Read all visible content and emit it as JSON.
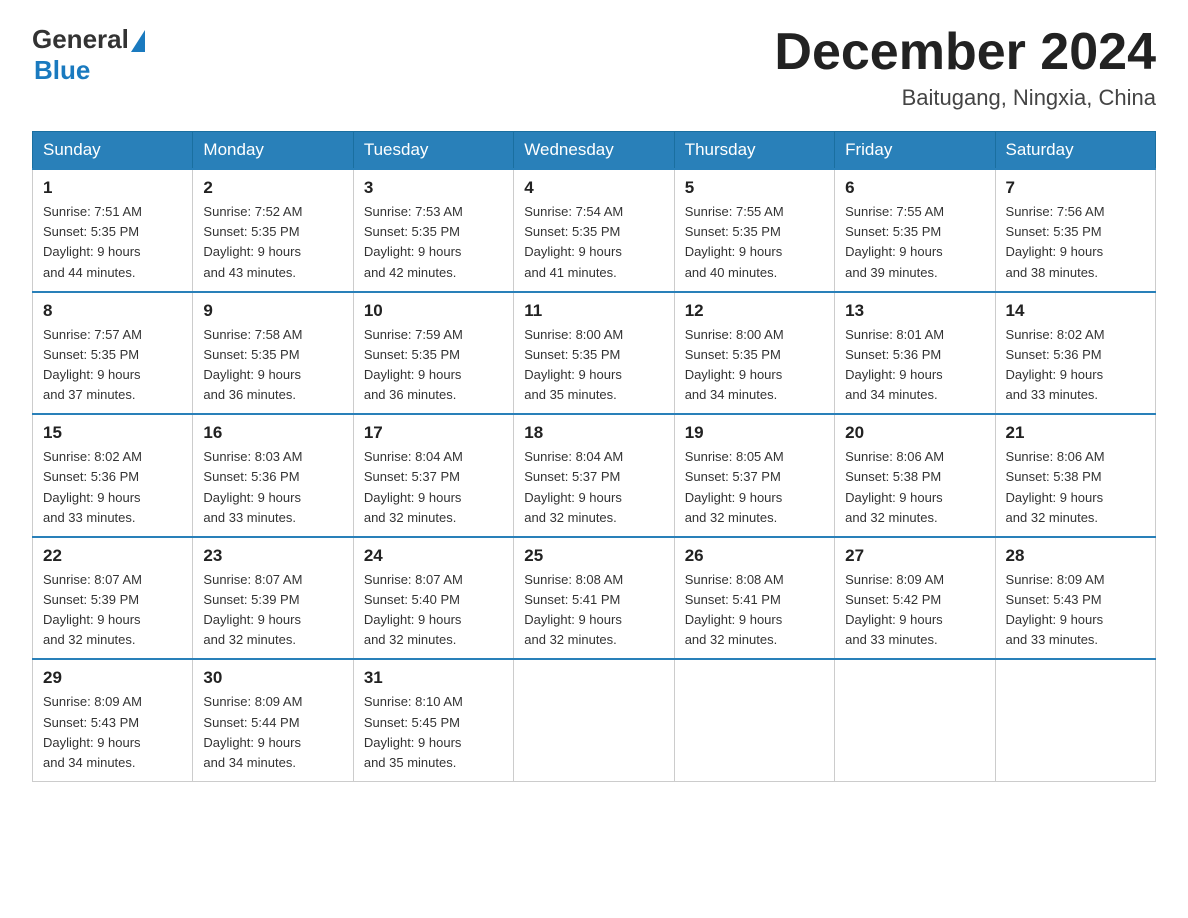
{
  "logo": {
    "general": "General",
    "blue": "Blue"
  },
  "title": {
    "month_year": "December 2024",
    "location": "Baitugang, Ningxia, China"
  },
  "weekdays": [
    "Sunday",
    "Monday",
    "Tuesday",
    "Wednesday",
    "Thursday",
    "Friday",
    "Saturday"
  ],
  "weeks": [
    [
      {
        "day": "1",
        "sunrise": "7:51 AM",
        "sunset": "5:35 PM",
        "daylight": "9 hours and 44 minutes."
      },
      {
        "day": "2",
        "sunrise": "7:52 AM",
        "sunset": "5:35 PM",
        "daylight": "9 hours and 43 minutes."
      },
      {
        "day": "3",
        "sunrise": "7:53 AM",
        "sunset": "5:35 PM",
        "daylight": "9 hours and 42 minutes."
      },
      {
        "day": "4",
        "sunrise": "7:54 AM",
        "sunset": "5:35 PM",
        "daylight": "9 hours and 41 minutes."
      },
      {
        "day": "5",
        "sunrise": "7:55 AM",
        "sunset": "5:35 PM",
        "daylight": "9 hours and 40 minutes."
      },
      {
        "day": "6",
        "sunrise": "7:55 AM",
        "sunset": "5:35 PM",
        "daylight": "9 hours and 39 minutes."
      },
      {
        "day": "7",
        "sunrise": "7:56 AM",
        "sunset": "5:35 PM",
        "daylight": "9 hours and 38 minutes."
      }
    ],
    [
      {
        "day": "8",
        "sunrise": "7:57 AM",
        "sunset": "5:35 PM",
        "daylight": "9 hours and 37 minutes."
      },
      {
        "day": "9",
        "sunrise": "7:58 AM",
        "sunset": "5:35 PM",
        "daylight": "9 hours and 36 minutes."
      },
      {
        "day": "10",
        "sunrise": "7:59 AM",
        "sunset": "5:35 PM",
        "daylight": "9 hours and 36 minutes."
      },
      {
        "day": "11",
        "sunrise": "8:00 AM",
        "sunset": "5:35 PM",
        "daylight": "9 hours and 35 minutes."
      },
      {
        "day": "12",
        "sunrise": "8:00 AM",
        "sunset": "5:35 PM",
        "daylight": "9 hours and 34 minutes."
      },
      {
        "day": "13",
        "sunrise": "8:01 AM",
        "sunset": "5:36 PM",
        "daylight": "9 hours and 34 minutes."
      },
      {
        "day": "14",
        "sunrise": "8:02 AM",
        "sunset": "5:36 PM",
        "daylight": "9 hours and 33 minutes."
      }
    ],
    [
      {
        "day": "15",
        "sunrise": "8:02 AM",
        "sunset": "5:36 PM",
        "daylight": "9 hours and 33 minutes."
      },
      {
        "day": "16",
        "sunrise": "8:03 AM",
        "sunset": "5:36 PM",
        "daylight": "9 hours and 33 minutes."
      },
      {
        "day": "17",
        "sunrise": "8:04 AM",
        "sunset": "5:37 PM",
        "daylight": "9 hours and 32 minutes."
      },
      {
        "day": "18",
        "sunrise": "8:04 AM",
        "sunset": "5:37 PM",
        "daylight": "9 hours and 32 minutes."
      },
      {
        "day": "19",
        "sunrise": "8:05 AM",
        "sunset": "5:37 PM",
        "daylight": "9 hours and 32 minutes."
      },
      {
        "day": "20",
        "sunrise": "8:06 AM",
        "sunset": "5:38 PM",
        "daylight": "9 hours and 32 minutes."
      },
      {
        "day": "21",
        "sunrise": "8:06 AM",
        "sunset": "5:38 PM",
        "daylight": "9 hours and 32 minutes."
      }
    ],
    [
      {
        "day": "22",
        "sunrise": "8:07 AM",
        "sunset": "5:39 PM",
        "daylight": "9 hours and 32 minutes."
      },
      {
        "day": "23",
        "sunrise": "8:07 AM",
        "sunset": "5:39 PM",
        "daylight": "9 hours and 32 minutes."
      },
      {
        "day": "24",
        "sunrise": "8:07 AM",
        "sunset": "5:40 PM",
        "daylight": "9 hours and 32 minutes."
      },
      {
        "day": "25",
        "sunrise": "8:08 AM",
        "sunset": "5:41 PM",
        "daylight": "9 hours and 32 minutes."
      },
      {
        "day": "26",
        "sunrise": "8:08 AM",
        "sunset": "5:41 PM",
        "daylight": "9 hours and 32 minutes."
      },
      {
        "day": "27",
        "sunrise": "8:09 AM",
        "sunset": "5:42 PM",
        "daylight": "9 hours and 33 minutes."
      },
      {
        "day": "28",
        "sunrise": "8:09 AM",
        "sunset": "5:43 PM",
        "daylight": "9 hours and 33 minutes."
      }
    ],
    [
      {
        "day": "29",
        "sunrise": "8:09 AM",
        "sunset": "5:43 PM",
        "daylight": "9 hours and 34 minutes."
      },
      {
        "day": "30",
        "sunrise": "8:09 AM",
        "sunset": "5:44 PM",
        "daylight": "9 hours and 34 minutes."
      },
      {
        "day": "31",
        "sunrise": "8:10 AM",
        "sunset": "5:45 PM",
        "daylight": "9 hours and 35 minutes."
      },
      null,
      null,
      null,
      null
    ]
  ],
  "labels": {
    "sunrise": "Sunrise:",
    "sunset": "Sunset:",
    "daylight": "Daylight:"
  }
}
